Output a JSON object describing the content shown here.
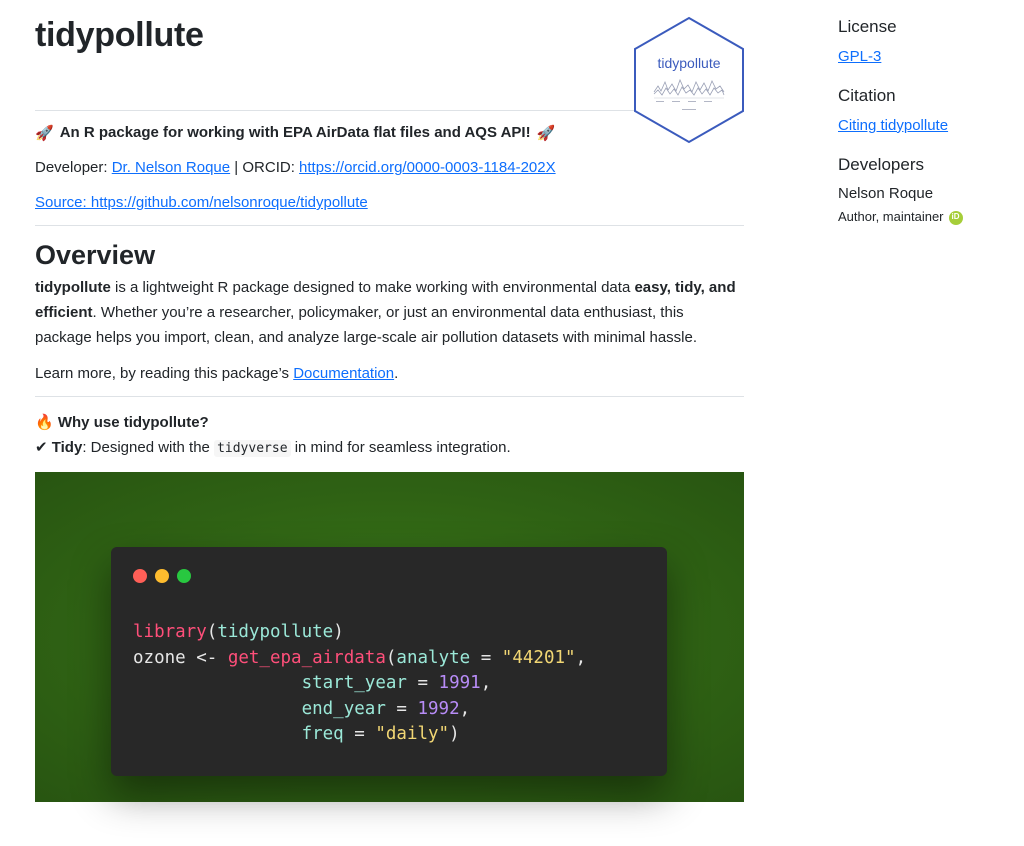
{
  "header": {
    "title": "tidypollute",
    "logo_text": "tidypollute"
  },
  "intro": {
    "rocket": "🚀",
    "tagline": "An R package for working with EPA AirData flat files and AQS API!",
    "developer_label": "Developer:",
    "developer_name": "Dr. Nelson Roque",
    "orcid_label": "| ORCID:",
    "orcid_url": "https://orcid.org/0000-0003-1184-202X",
    "source_link": "Source: https://github.com/nelsonroque/tidypollute"
  },
  "overview": {
    "heading": "Overview",
    "p1_bold": "tidypollute",
    "p1_text1": " is a lightweight R package designed to make working with environmental data ",
    "p1_bold2": "easy, tidy, and efficient",
    "p1_text2": ". Whether you’re a researcher, policymaker, or just an environmental data enthusiast, this package helps you import, clean, and analyze large-scale air pollution datasets with minimal hassle.",
    "learn_text": "Learn more, by reading this package’s ",
    "learn_link": "Documentation",
    "learn_end": "."
  },
  "why": {
    "fire": "🔥",
    "heading": "Why use tidypollute?",
    "check": "✔",
    "tidy_bold": "Tidy",
    "tidy_text1": ": Designed with the ",
    "tidy_code": "tidyverse",
    "tidy_text2": " in mind for seamless integration."
  },
  "code_window": {
    "dot_colors": [
      "#ff5f57",
      "#febc2e",
      "#28c840"
    ],
    "line1_fn": "library",
    "line1_open": "(",
    "line1_arg": "tidypollute",
    "line1_close": ")",
    "line2_var": "ozone <- ",
    "line2_fn": "get_epa_airdata",
    "line2_open": "(",
    "line2_arg": "analyte",
    "line2_eq": " = ",
    "line2_val": "\"44201\"",
    "line2_comma": ",",
    "line3_arg": "start_year",
    "line3_eq": " = ",
    "line3_val": "1991",
    "line3_comma": ",",
    "line4_arg": "end_year",
    "line4_eq": " = ",
    "line4_val": "1992",
    "line4_comma": ",",
    "line5_arg": "freq",
    "line5_eq": " = ",
    "line5_val": "\"daily\"",
    "line5_close": ")"
  },
  "sidebar": {
    "license_heading": "License",
    "license_link": "GPL-3",
    "citation_heading": "Citation",
    "citation_link": "Citing tidypollute",
    "developers_heading": "Developers",
    "developer_name": "Nelson Roque",
    "developer_role": "Author, maintainer",
    "orcid_badge": "iD"
  },
  "colors": {
    "link": "#0d6efd",
    "banner_green": "#2f6214",
    "code_bg": "#282828",
    "orcid_green": "#a6ce39",
    "hex_border": "#3b5bbd"
  }
}
